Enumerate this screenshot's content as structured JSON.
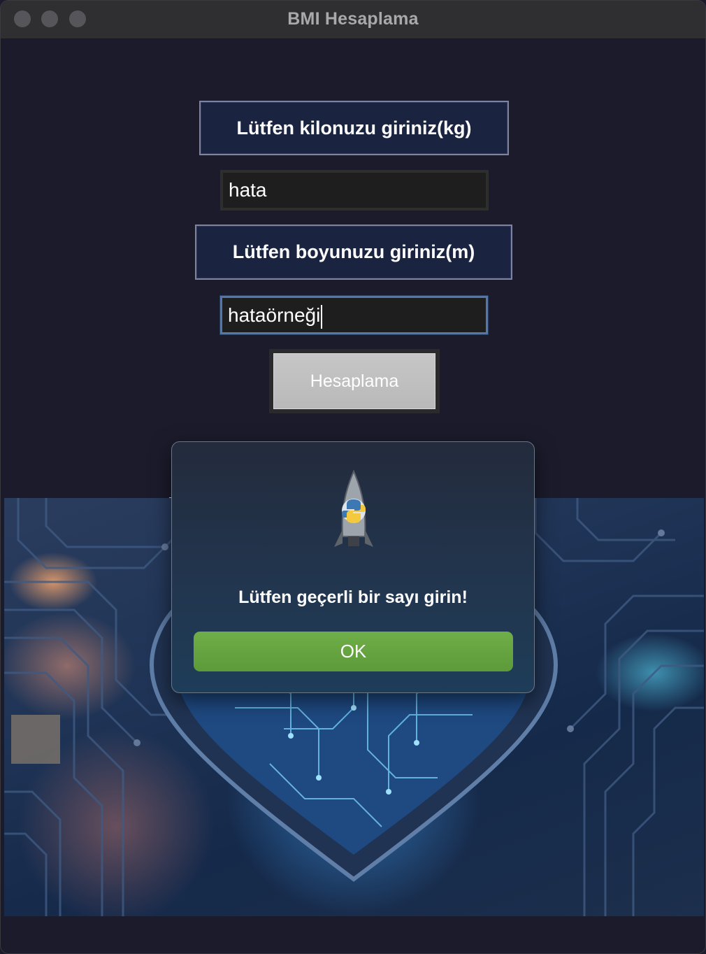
{
  "window": {
    "title": "BMI Hesaplama"
  },
  "form": {
    "weight_label": "Lütfen kilonuzu giriniz(kg)",
    "weight_value": "hata",
    "height_label": "Lütfen boyunuzu giriniz(m)",
    "height_value": "hataörneği",
    "calculate_label": "Hesaplama"
  },
  "dialog": {
    "icon": "python-rocket-icon",
    "message": "Lütfen geçerli bir sayı girin!",
    "ok_label": "OK"
  },
  "colors": {
    "window_bg": "#1c1b2e",
    "label_bg": "#1a2340",
    "ok_button": "#65a440",
    "focus_border": "#5177ad"
  }
}
